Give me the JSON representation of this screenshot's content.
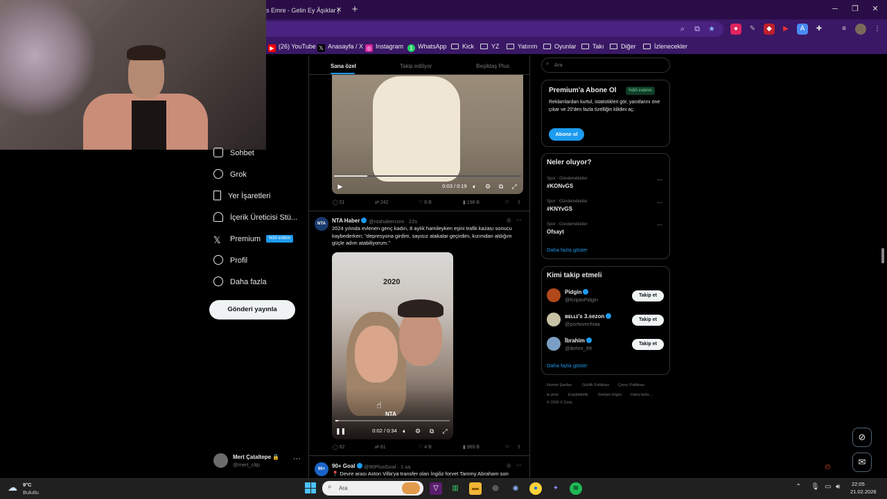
{
  "browser": {
    "tab_title": "s Emre - Gelin Ey Âşıklar |",
    "tab_close": "×",
    "new_tab": "+",
    "window_controls": [
      "─",
      "❐",
      "✕"
    ],
    "bookmarks": [
      {
        "label": "(26) YouTube",
        "icon": "youtube-icon",
        "color": "#ff0000"
      },
      {
        "label": "Anasayfa / X",
        "icon": "x-logo-icon",
        "color": "#000000"
      },
      {
        "label": "Instagram",
        "icon": "instagram-icon",
        "color": "#d6249f"
      },
      {
        "label": "WhatsApp",
        "icon": "whatsapp-icon",
        "color": "#25d366"
      },
      {
        "label": "Kick",
        "icon": "folder-icon"
      },
      {
        "label": "YZ",
        "icon": "folder-icon"
      },
      {
        "label": "Yatırım",
        "icon": "folder-icon"
      },
      {
        "label": "Oyunlar",
        "icon": "folder-icon"
      },
      {
        "label": "Takı",
        "icon": "folder-icon"
      },
      {
        "label": "Diğer",
        "icon": "folder-icon"
      },
      {
        "label": "İzlenecekler",
        "icon": "folder-icon"
      }
    ]
  },
  "sidebar": {
    "items": [
      {
        "label": "Sohbet",
        "icon": "mail-icon"
      },
      {
        "label": "Grok",
        "icon": "grok-icon"
      },
      {
        "label": "Yer İşaretleri",
        "icon": "bookmark-icon"
      },
      {
        "label": "İçerik Üreticisi Stü...",
        "icon": "creator-studio-icon"
      },
      {
        "label": "Premium",
        "icon": "x-logo-icon",
        "badge": "%50 indirim"
      },
      {
        "label": "Profil",
        "icon": "profile-icon"
      },
      {
        "label": "Daha fazla",
        "icon": "more-circle-icon"
      }
    ],
    "post_button": "Gönderi yayınla",
    "account": {
      "name": "Mert Çataltepe 🔒",
      "handle": "@mert_cttp",
      "more": "···"
    }
  },
  "timeline": {
    "tabs": [
      "Sana özel",
      "Takip ediliyor",
      "Beşiktaş Plus"
    ],
    "active_tab": "Sana özel",
    "tweet1": {
      "video_time": "0:03 / 0:19",
      "actions": {
        "replies": "51",
        "reposts": "242",
        "likes": "8 B",
        "views": "198 B"
      }
    },
    "tweet2": {
      "name": "NTA Haber",
      "handle": "@ntahabercom · 22s",
      "text": "2024 yılında evlenen genç kadın, 8 aylık hamileyken eşini trafik kazası sonucu kaybederken; \"depresyona girdim, sayısız atakalar geçirdim, kızımdan aldığım güçle adım atabiliyorum.\"",
      "video_overlay_year": "2020",
      "video_logo": "NTA",
      "video_time": "0:02 / 0:34",
      "actions": {
        "replies": "62",
        "reposts": "61",
        "likes": "4 B",
        "views": "989 B"
      }
    },
    "tweet3": {
      "name": "90+ Goal",
      "handle": "@90PlusGoal · 1 sa",
      "text": "📍 Devre arası Aston Villa'ya transfer olan İngiliz forvet Tammy Abraham son"
    }
  },
  "right": {
    "search_placeholder": "Ara",
    "premium": {
      "title": "Premium'a Abone Ol",
      "badge": "%50 indirim",
      "body": "Reklamlardan kurtul, istatistikleri gör, yanıtlarını öne çıkar ve 20'den fazla özelliğin kilidini aç.",
      "button": "Abone ol"
    },
    "trends": {
      "title": "Neler oluyor?",
      "items": [
        {
          "category": "Spor · Gündemdekiler",
          "name": "#KONvGS"
        },
        {
          "category": "Spor · Gündemdekiler",
          "name": "#KNYvGS"
        },
        {
          "category": "Spor · Gündemdekiler",
          "name": "Ofsayt"
        }
      ],
      "more": "Daha fazla göster"
    },
    "follow": {
      "title": "Kimi takip etmeli",
      "items": [
        {
          "name": "Pidgin",
          "handle": "@KriptoPidgin",
          "button": "Takip et"
        },
        {
          "name": "ʙᴇʟʟɪ's 3.sezon",
          "handle": "@portovechiaa",
          "button": "Takip et"
        },
        {
          "name": "İbrahim",
          "handle": "@ibrhm_99",
          "button": "Takip et"
        }
      ],
      "more": "Daha fazla göster"
    },
    "footer": [
      "Hizmet Şartları",
      "Gizlilik Politikası",
      "Çerez Politikası",
      "Erişilebilirlik",
      "Reklam bilgisi",
      "Daha fazla ...",
      "© 2026 X Corp."
    ],
    "footer_imprint": "te print"
  },
  "taskbar": {
    "weather_temp": "9°C",
    "weather_cond": "Bulutlu",
    "search": "Ara",
    "time": "22:05",
    "date": "21.02.2026"
  }
}
